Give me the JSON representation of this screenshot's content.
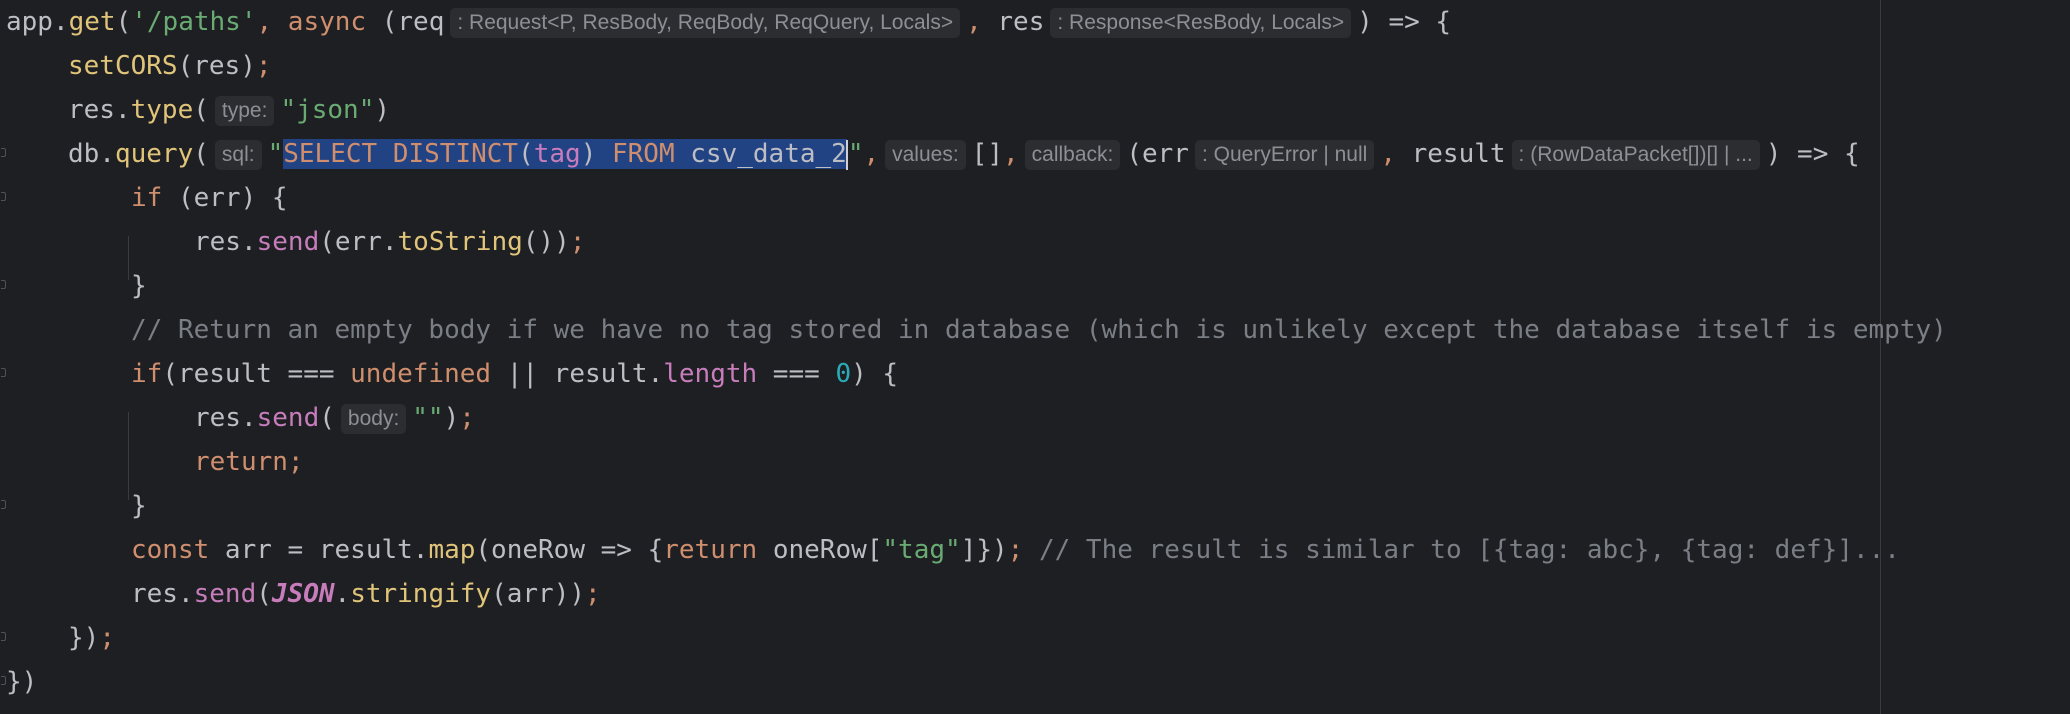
{
  "editor": {
    "lines": [
      {
        "tokens": [
          {
            "t": "app.",
            "c": ""
          },
          {
            "t": "get",
            "c": "mth"
          },
          {
            "t": "(",
            "c": ""
          },
          {
            "t": "'/paths'",
            "c": "str"
          },
          {
            "t": ", ",
            "c": "kw"
          },
          {
            "t": "async",
            "c": "kw"
          },
          {
            "t": " (req",
            "c": ""
          },
          {
            "h": ": Request<P, ResBody, ReqBody, ReqQuery, Locals>"
          },
          {
            "t": ", ",
            "c": "kw"
          },
          {
            "t": "res",
            "c": ""
          },
          {
            "h": ": Response<ResBody, Locals>"
          },
          {
            "t": ") => {",
            "c": ""
          }
        ]
      },
      {
        "tokens": [
          {
            "t": "setCORS",
            "c": "mth"
          },
          {
            "t": "(res)",
            "c": ""
          },
          {
            "t": ";",
            "c": "kw"
          }
        ]
      },
      {
        "tokens": [
          {
            "t": "res.",
            "c": ""
          },
          {
            "t": "type",
            "c": "mth"
          },
          {
            "t": "(",
            "c": ""
          },
          {
            "h": "type:"
          },
          {
            "t": "\"json\"",
            "c": "str"
          },
          {
            "t": ")",
            "c": ""
          }
        ]
      },
      {
        "tokens": [
          {
            "t": "db.",
            "c": ""
          },
          {
            "t": "query",
            "c": "mth"
          },
          {
            "t": "(",
            "c": ""
          },
          {
            "h": "sql:"
          },
          {
            "t": "\"",
            "c": "str"
          },
          {
            "t": "SELECT DISTINCT",
            "c": "kw",
            "sel": true
          },
          {
            "t": "(",
            "c": "",
            "sel": true
          },
          {
            "t": "tag",
            "c": "prop",
            "sel": true
          },
          {
            "t": ") ",
            "c": "",
            "sel": true
          },
          {
            "t": "FROM",
            "c": "kw",
            "sel": true
          },
          {
            "t": " csv_data_2",
            "c": "",
            "sel": true
          },
          {
            "caret": true
          },
          {
            "t": "\"",
            "c": "str"
          },
          {
            "t": ",",
            "c": "kw"
          },
          {
            "h": "values:"
          },
          {
            "t": "[]",
            "c": ""
          },
          {
            "t": ",",
            "c": "kw"
          },
          {
            "h": "callback:"
          },
          {
            "t": "(err",
            "c": ""
          },
          {
            "h": ": QueryError | null"
          },
          {
            "t": ", ",
            "c": "kw"
          },
          {
            "t": "result",
            "c": ""
          },
          {
            "h": ": (RowDataPacket[])[] | ..."
          },
          {
            "t": ") => {",
            "c": ""
          }
        ]
      },
      {
        "tokens": [
          {
            "t": "if",
            "c": "kw"
          },
          {
            "t": " (err) {",
            "c": ""
          }
        ]
      },
      {
        "tokens": [
          {
            "t": "res.",
            "c": ""
          },
          {
            "t": "send",
            "c": "prop"
          },
          {
            "t": "(err.",
            "c": ""
          },
          {
            "t": "toString",
            "c": "mth"
          },
          {
            "t": "())",
            "c": ""
          },
          {
            "t": ";",
            "c": "kw"
          }
        ]
      },
      {
        "tokens": [
          {
            "t": "}",
            "c": ""
          }
        ]
      },
      {
        "tokens": [
          {
            "t": "// Return an empty body if we have no tag stored in database (which is unlikely except the database itself is empty)",
            "c": "cmt"
          }
        ]
      },
      {
        "tokens": [
          {
            "t": "if",
            "c": "kw"
          },
          {
            "t": "(result === ",
            "c": ""
          },
          {
            "t": "undefined",
            "c": "kw"
          },
          {
            "t": " || result.",
            "c": ""
          },
          {
            "t": "length",
            "c": "prop"
          },
          {
            "t": " === ",
            "c": ""
          },
          {
            "t": "0",
            "c": "num"
          },
          {
            "t": ") {",
            "c": ""
          }
        ]
      },
      {
        "tokens": [
          {
            "t": "res.",
            "c": ""
          },
          {
            "t": "send",
            "c": "prop"
          },
          {
            "t": "(",
            "c": ""
          },
          {
            "h": "body:"
          },
          {
            "t": "\"\"",
            "c": "str"
          },
          {
            "t": ")",
            "c": ""
          },
          {
            "t": ";",
            "c": "kw"
          }
        ]
      },
      {
        "tokens": [
          {
            "t": "return",
            "c": "kw"
          },
          {
            "t": ";",
            "c": "kw"
          }
        ]
      },
      {
        "tokens": [
          {
            "t": "}",
            "c": ""
          }
        ]
      },
      {
        "tokens": [
          {
            "t": "const",
            "c": "kw"
          },
          {
            "t": " arr = result.",
            "c": ""
          },
          {
            "t": "map",
            "c": "mth"
          },
          {
            "t": "(oneRow => {",
            "c": ""
          },
          {
            "t": "return",
            "c": "kw"
          },
          {
            "t": " oneRow[",
            "c": ""
          },
          {
            "t": "\"tag\"",
            "c": "str"
          },
          {
            "t": "]})",
            "c": ""
          },
          {
            "t": "; ",
            "c": "kw"
          },
          {
            "t": "// The result is similar to [{tag: abc}, {tag: def}]...",
            "c": "cmt"
          }
        ]
      },
      {
        "tokens": [
          {
            "t": "res.",
            "c": ""
          },
          {
            "t": "send",
            "c": "prop"
          },
          {
            "t": "(",
            "c": ""
          },
          {
            "t": "JSON",
            "c": "cls"
          },
          {
            "t": ".",
            "c": ""
          },
          {
            "t": "stringify",
            "c": "mth"
          },
          {
            "t": "(arr))",
            "c": ""
          },
          {
            "t": ";",
            "c": "kw"
          }
        ]
      },
      {
        "tokens": [
          {
            "t": "})",
            "c": ""
          },
          {
            "t": ";",
            "c": "kw"
          }
        ]
      },
      {
        "tokens": [
          {
            "t": "})",
            "c": ""
          }
        ]
      }
    ]
  }
}
